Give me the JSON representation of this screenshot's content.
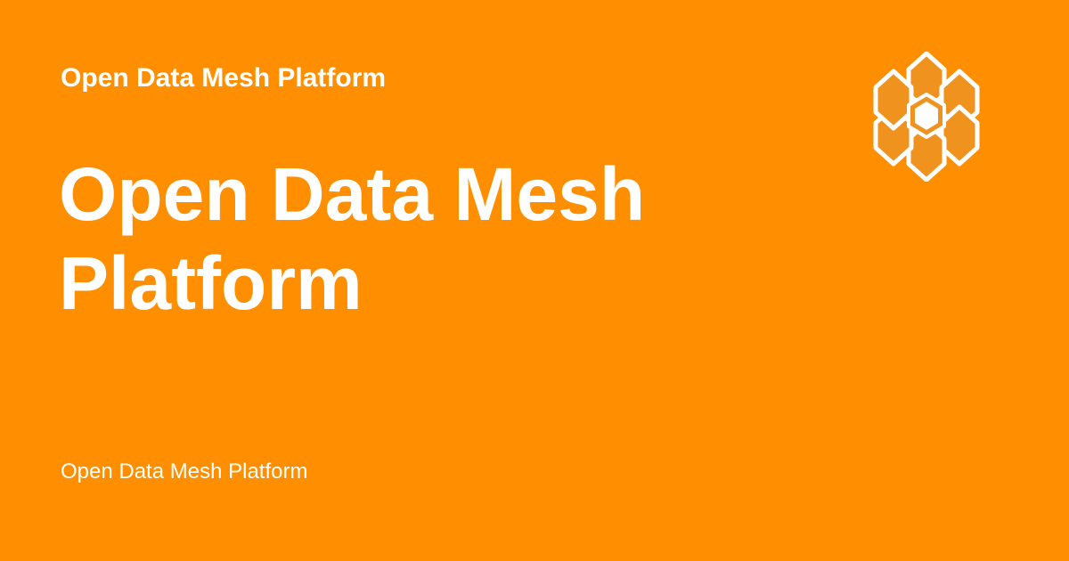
{
  "header": {
    "site_name": "Open Data Mesh Platform"
  },
  "main": {
    "title": "Open Data Mesh Platform"
  },
  "footer": {
    "description": "Open Data Mesh Platform"
  },
  "logo": {
    "icon": "honeycomb-logo-icon"
  },
  "colors": {
    "background": "#ff8f00",
    "text": "#ffffff",
    "logo_fill": "#f0921e",
    "logo_stroke": "#ffffff"
  }
}
